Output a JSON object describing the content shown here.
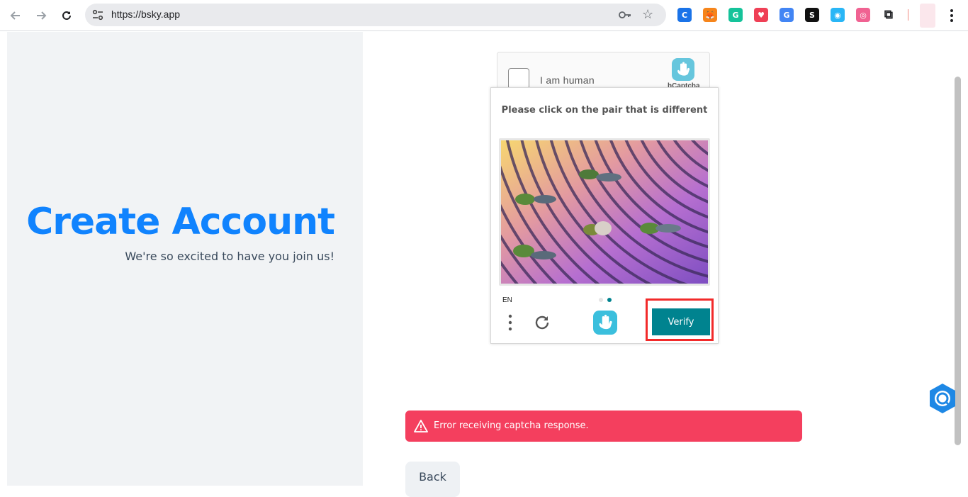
{
  "browser": {
    "url": "https://bsky.app",
    "back_icon": "arrow-left-icon",
    "forward_icon": "arrow-right-icon",
    "reload_icon": "reload-icon",
    "extensions": [
      {
        "name": "copyright-extension",
        "glyph": "C",
        "color": "#1a73e8"
      },
      {
        "name": "metamask-extension",
        "glyph": "🦊",
        "color": "#f6851b"
      },
      {
        "name": "grammarly-extension",
        "glyph": "G",
        "color": "#15c39a"
      },
      {
        "name": "pocket-extension",
        "glyph": "♥",
        "color": "#ef4056"
      },
      {
        "name": "translate-extension",
        "glyph": "G",
        "color": "#4285f4"
      },
      {
        "name": "scribe-extension",
        "glyph": "S",
        "color": "#111111"
      },
      {
        "name": "lens-extension",
        "glyph": "◉",
        "color": "#29b6f6"
      },
      {
        "name": "camera-extension",
        "glyph": "◎",
        "color": "#f06292"
      }
    ]
  },
  "left_panel": {
    "title": "Create Account",
    "subtitle": "We're so excited to have you join us!"
  },
  "captcha_anchor": {
    "label": "I am human",
    "brand": "hCaptcha"
  },
  "challenge": {
    "prompt": "Please click on the pair that is different",
    "language": "EN",
    "verify_label": "Verify",
    "page_count": 2,
    "current_page": 2
  },
  "error": {
    "message": "Error receiving captcha response."
  },
  "back_label": "Back",
  "colors": {
    "accent": "#1083fe",
    "error": "#f43f5e",
    "verify": "#00838f",
    "highlight": "#f22a2a"
  }
}
